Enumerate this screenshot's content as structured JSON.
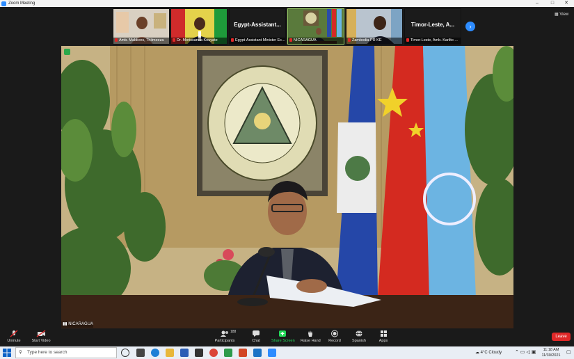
{
  "window": {
    "title": "Zoom Meeting",
    "controls": [
      "–",
      "□",
      "✕"
    ]
  },
  "thumbnails": [
    {
      "name": "Amb. Maldives, Thilmeeza",
      "kind": "video"
    },
    {
      "name": "Dr. Morissanda Kouyate",
      "kind": "video"
    },
    {
      "name": "Egypt-Assistant Minister Ec...",
      "big_name": "Egypt-Assistant...",
      "kind": "name"
    },
    {
      "name": "NICARAGUA",
      "kind": "video"
    },
    {
      "name": "Zambodia PR KE",
      "kind": "video"
    },
    {
      "name": "Timor-Leste, Amb. Karlito ...",
      "big_name": "Timor-Leste, A...",
      "kind": "name"
    }
  ],
  "view_label": "View",
  "next_label": "›",
  "speaker": {
    "name": "NICARAGUA",
    "seal_top": "REPUBLICA DE NICARAGUA",
    "seal_bottom": "AMERICA CENTRAL"
  },
  "toolbar": {
    "unmute": "Unmute",
    "start_video": "Start Video",
    "participants": "Participants",
    "participants_count": "188",
    "chat": "Chat",
    "share_screen": "Share Screen",
    "raise_hand": "Raise Hand",
    "record": "Record",
    "spanish": "Spanish",
    "apps": "Apps",
    "leave": "Leave"
  },
  "taskbar": {
    "search_placeholder": "Type here to search",
    "weather": "4°C  Cloudy",
    "time": "11:18 AM",
    "date": "11/30/2021"
  },
  "colors": {
    "accent": "#2d8cff",
    "leave": "#e02828",
    "share": "#23d959"
  }
}
